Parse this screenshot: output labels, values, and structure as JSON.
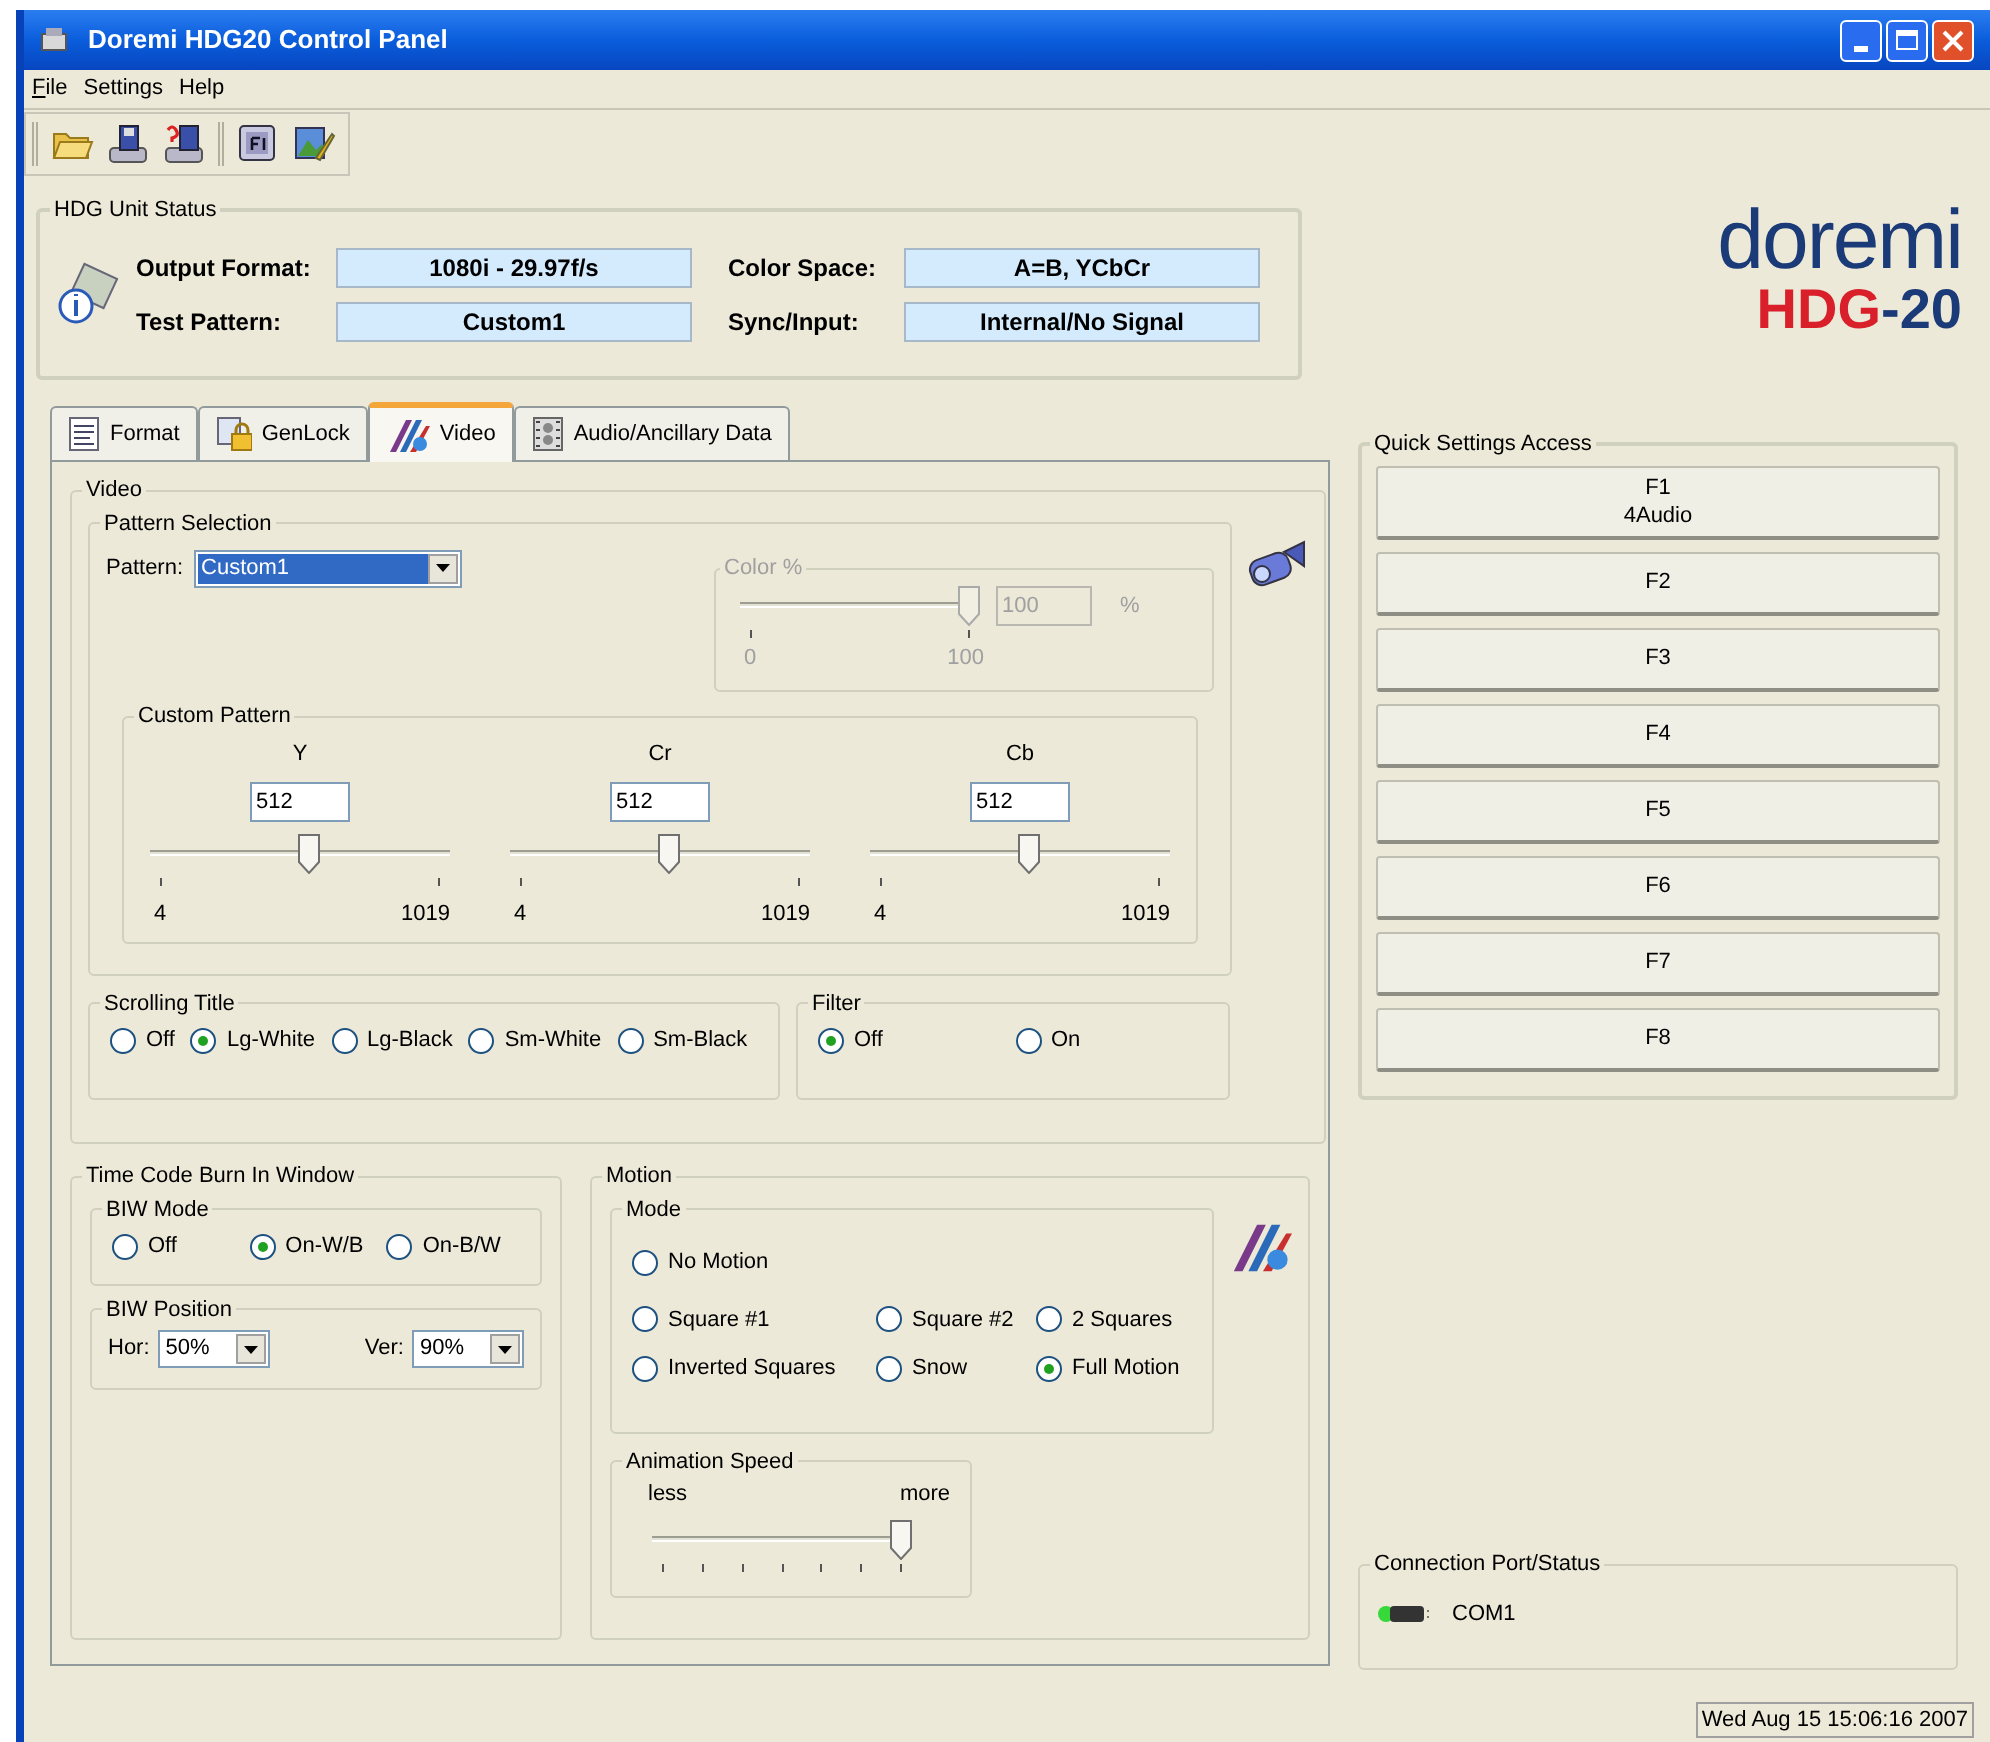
{
  "window": {
    "title": "Doremi HDG20 Control Panel"
  },
  "menu": [
    {
      "label": "File",
      "underline_first": true
    },
    {
      "label": "Settings",
      "underline_first": false
    },
    {
      "label": "Help",
      "underline_first": false
    }
  ],
  "status": {
    "title": "HDG Unit Status",
    "fields": [
      {
        "label": "Output Format:",
        "value": "1080i - 29.97f/s"
      },
      {
        "label": "Color Space:",
        "value": "A=B, YCbCr"
      },
      {
        "label": "Test Pattern:",
        "value": "Custom1"
      },
      {
        "label": "Sync/Input:",
        "value": "Internal/No Signal"
      }
    ]
  },
  "logo": {
    "word": "doremi",
    "model": "HDG",
    "suffix": "-20"
  },
  "tabs": [
    {
      "label": "Format",
      "selected": false,
      "kind": "document"
    },
    {
      "label": "GenLock",
      "selected": false,
      "kind": "lock"
    },
    {
      "label": "Video",
      "selected": true,
      "kind": "stripes"
    },
    {
      "label": "Audio/Ancillary Data",
      "selected": false,
      "kind": "film"
    }
  ],
  "video": {
    "title": "Video",
    "pattern_selection": {
      "title": "Pattern Selection",
      "pattern_label": "Pattern:",
      "pattern_value": "Custom1",
      "highlighted": true,
      "color": {
        "title": "Color %",
        "value": "100",
        "unit": "%",
        "min": "0",
        "max": "100",
        "level": 1,
        "disabled": true
      }
    },
    "custom_pattern": {
      "title": "Custom Pattern",
      "channels": [
        {
          "name": "Y",
          "value": "512",
          "min": "4",
          "max": "1019",
          "level": 0.53
        },
        {
          "name": "Cr",
          "value": "512",
          "min": "4",
          "max": "1019",
          "level": 0.53
        },
        {
          "name": "Cb",
          "value": "512",
          "min": "4",
          "max": "1019",
          "level": 0.53
        }
      ]
    },
    "scrolling_title": {
      "title": "Scrolling Title",
      "options": [
        {
          "label": "Off",
          "selected": false
        },
        {
          "label": "Lg-White",
          "selected": true
        },
        {
          "label": "Lg-Black",
          "selected": false
        },
        {
          "label": "Sm-White",
          "selected": false
        },
        {
          "label": "Sm-Black",
          "selected": false
        }
      ]
    },
    "filter": {
      "title": "Filter",
      "options": [
        {
          "label": "Off",
          "selected": true
        },
        {
          "label": "On",
          "selected": false
        }
      ]
    }
  },
  "time_code": {
    "title": "Time Code Burn In Window",
    "biw_mode": {
      "title": "BIW Mode",
      "options": [
        {
          "label": "Off",
          "selected": false
        },
        {
          "label": "On-W/B",
          "selected": true
        },
        {
          "label": "On-B/W",
          "selected": false
        }
      ]
    },
    "biw_position": {
      "title": "BIW Position",
      "hor": {
        "label": "Hor:",
        "value": "50%"
      },
      "ver": {
        "label": "Ver:",
        "value": "90%"
      }
    }
  },
  "motion": {
    "title": "Motion",
    "mode": {
      "title": "Mode",
      "rows": [
        {
          "options": [
            {
              "label": "No Motion",
              "selected": false
            }
          ]
        },
        {
          "options": [
            {
              "label": "Square #1",
              "selected": false
            },
            {
              "label": "Square #2",
              "selected": false
            },
            {
              "label": "2 Squares",
              "selected": false
            }
          ]
        },
        {
          "options": [
            {
              "label": "Inverted Squares",
              "selected": false
            },
            {
              "label": "Snow",
              "selected": false
            },
            {
              "label": "Full Motion",
              "selected": true
            }
          ]
        }
      ]
    },
    "animation_speed": {
      "title": "Animation Speed",
      "min_label": "less",
      "max_label": "more",
      "level": 1
    }
  },
  "quick_settings": {
    "title": "Quick Settings Access",
    "buttons": [
      {
        "label": "F1",
        "sublabel": "4Audio"
      },
      {
        "label": "F2"
      },
      {
        "label": "F3"
      },
      {
        "label": "F4"
      },
      {
        "label": "F5"
      },
      {
        "label": "F6"
      },
      {
        "label": "F7"
      },
      {
        "label": "F8"
      }
    ]
  },
  "connection": {
    "title": "Connection Port/Status",
    "port": "COM1"
  },
  "status_bar": {
    "datetime": "Wed Aug 15 15:06:16 2007"
  }
}
